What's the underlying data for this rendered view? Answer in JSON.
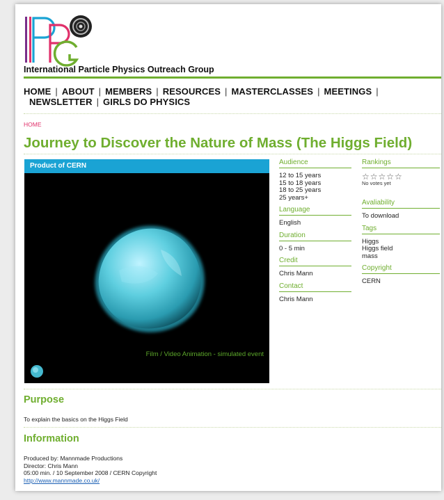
{
  "site": {
    "org_name": "International Particle Physics Outreach Group"
  },
  "nav": {
    "items_row1": [
      "HOME",
      "ABOUT",
      "MEMBERS",
      "RESOURCES",
      "MASTERCLASSES",
      "MEETINGS"
    ],
    "items_row2": [
      "NEWSLETTER",
      "GIRLS DO PHYSICS"
    ]
  },
  "breadcrumb": "HOME",
  "page": {
    "title": "Journey to Discover the Nature of Mass (The Higgs Field)"
  },
  "video": {
    "header": "Product of CERN",
    "caption": "Film / Video  Animation - simulated event"
  },
  "meta_left": {
    "audience_label": "Audience",
    "audience": [
      "12 to 15 years",
      "15 to 18 years",
      "18 to 25 years",
      "25 years+"
    ],
    "language_label": "Language",
    "language": "English",
    "duration_label": "Duration",
    "duration": "0 - 5 min",
    "credit_label": "Credit",
    "credit": "Chris Mann",
    "contact_label": "Contact",
    "contact": "Chris Mann"
  },
  "meta_right": {
    "rankings_label": "Rankings",
    "stars": "☆☆☆☆☆",
    "rating": 0,
    "no_votes": "No votes yet",
    "availability_label": "Avaliability",
    "availability": "To download",
    "tags_label": "Tags",
    "tags": [
      "Higgs",
      "Higgs field",
      "mass"
    ],
    "copyright_label": "Copyright",
    "copyright": "CERN"
  },
  "purpose": {
    "title": "Purpose",
    "text": "To explain the basics on the Higgs Field"
  },
  "information": {
    "title": "Information",
    "lines": [
      "Produced by: Mannmade Productions",
      "Director: Chris Mann",
      "05:00 min. / 10 September 2008 / CERN Copyright"
    ],
    "link": "http://www.mannmade.co.uk/"
  },
  "colors": {
    "accent_green": "#6fae2f",
    "header_blue": "#1aa3d4",
    "breadcrumb_pink": "#e0306a"
  }
}
